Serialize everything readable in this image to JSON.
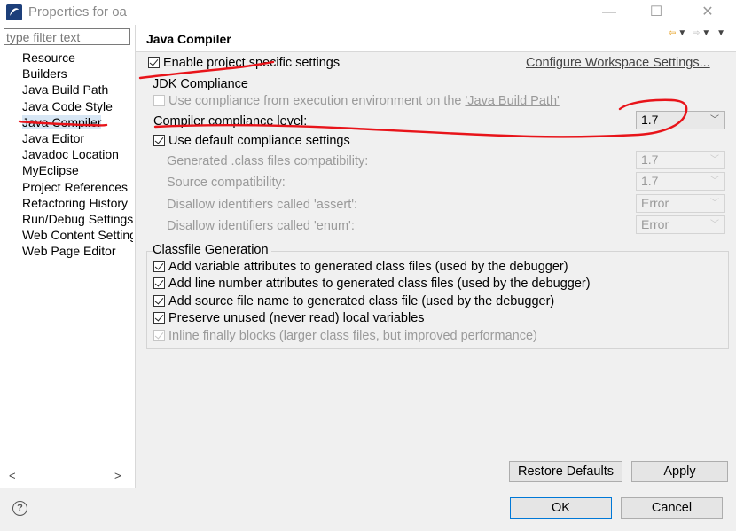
{
  "window": {
    "title": "Properties for oa",
    "minimize_glyph": "—",
    "maximize_glyph": "☐",
    "close_glyph": "✕"
  },
  "sidebar": {
    "filter_placeholder": "type filter text",
    "items": [
      {
        "label": "Resource"
      },
      {
        "label": "Builders"
      },
      {
        "label": "Java Build Path"
      },
      {
        "label": "Java Code Style"
      },
      {
        "label": "Java Compiler",
        "selected": true
      },
      {
        "label": "Java Editor"
      },
      {
        "label": "Javadoc Location"
      },
      {
        "label": "MyEclipse"
      },
      {
        "label": "Project References"
      },
      {
        "label": "Refactoring History"
      },
      {
        "label": "Run/Debug Settings"
      },
      {
        "label": "Web Content Settings"
      },
      {
        "label": "Web Page Editor"
      }
    ],
    "scroll_left": "<",
    "scroll_right": ">"
  },
  "main": {
    "title": "Java Compiler",
    "enable_project_specific": "Enable project specific settings",
    "configure_workspace_link": "Configure Workspace Settings...",
    "jdk_group": {
      "label": "JDK Compliance",
      "use_compliance_prefix": "Use compliance from execution environment on the ",
      "use_compliance_link": "'Java Build Path'",
      "compliance_level_label": "Compiler compliance level:",
      "compliance_level_value": "1.7",
      "use_default": "Use default compliance settings",
      "generated_label": "Generated .class files compatibility:",
      "generated_value": "1.7",
      "source_label": "Source compatibility:",
      "source_value": "1.7",
      "assert_label": "Disallow identifiers called 'assert':",
      "assert_value": "Error",
      "enum_label": "Disallow identifiers called 'enum':",
      "enum_value": "Error"
    },
    "classfile_group": {
      "label": "Classfile Generation",
      "options": [
        {
          "label": "Add variable attributes to generated class files (used by the debugger)",
          "checked": true,
          "enabled": true
        },
        {
          "label": "Add line number attributes to generated class files (used by the debugger)",
          "checked": true,
          "enabled": true
        },
        {
          "label": "Add source file name to generated class file (used by the debugger)",
          "checked": true,
          "enabled": true
        },
        {
          "label": "Preserve unused (never read) local variables",
          "checked": true,
          "enabled": true
        },
        {
          "label": "Inline finally blocks (larger class files, but improved performance)",
          "checked": true,
          "enabled": false
        }
      ]
    },
    "restore_defaults": "Restore Defaults",
    "apply": "Apply"
  },
  "footer": {
    "help_glyph": "?",
    "ok": "OK",
    "cancel": "Cancel"
  },
  "annotation_color": "#e8141a"
}
